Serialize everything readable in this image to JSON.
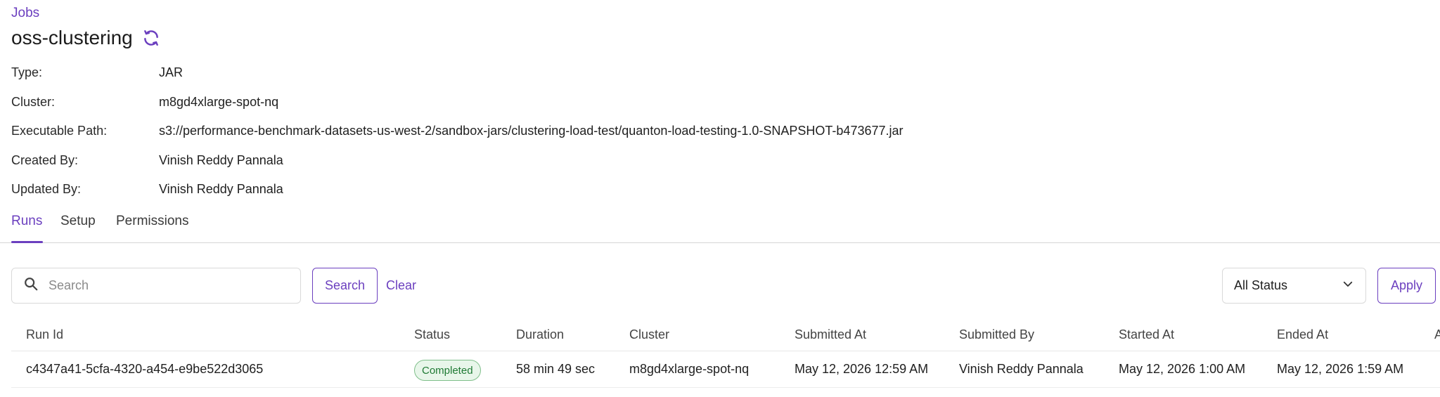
{
  "breadcrumb": {
    "label": "Jobs"
  },
  "page": {
    "title": "oss-clustering"
  },
  "details": [
    {
      "label": "Type:",
      "value": "JAR",
      "is_link": false
    },
    {
      "label": "Cluster:",
      "value": "m8gd4xlarge-spot-nq",
      "is_link": true
    },
    {
      "label": "Executable Path:",
      "value": "s3://performance-benchmark-datasets-us-west-2/sandbox-jars/clustering-load-test/quanton-load-testing-1.0-SNAPSHOT-b473677.jar",
      "is_link": false
    },
    {
      "label": "Created By:",
      "value": "Vinish Reddy Pannala",
      "is_link": false
    },
    {
      "label": "Updated By:",
      "value": "Vinish Reddy Pannala",
      "is_link": false
    }
  ],
  "tabs": [
    {
      "label": "Runs",
      "active": true
    },
    {
      "label": "Setup",
      "active": false
    },
    {
      "label": "Permissions",
      "active": false
    }
  ],
  "filters": {
    "search_placeholder": "Search",
    "search_value": "",
    "search_button": "Search",
    "clear_button": "Clear",
    "status_selected": "All Status",
    "apply_button": "Apply"
  },
  "table": {
    "headers": [
      "Run Id",
      "Status",
      "Duration",
      "Cluster",
      "Submitted At",
      "Submitted By",
      "Started At",
      "Ended At",
      "A"
    ],
    "rows": [
      {
        "run_id": "c4347a41-5cfa-4320-a454-e9be522d3065",
        "status": "Completed",
        "duration": "58 min 49 sec",
        "cluster": "m8gd4xlarge-spot-nq",
        "submitted_at": "May 12, 2026 12:59 AM",
        "submitted_by": "Vinish Reddy Pannala",
        "started_at": "May 12, 2026 1:00 AM",
        "ended_at": "May 12, 2026 1:59 AM"
      }
    ]
  },
  "colors": {
    "accent": "#6b3fbf",
    "status_completed_bg": "#e8f6ea",
    "status_completed_text": "#1f7a34"
  },
  "icons": [
    "refresh-icon",
    "search-icon",
    "chevron-down-icon"
  ]
}
